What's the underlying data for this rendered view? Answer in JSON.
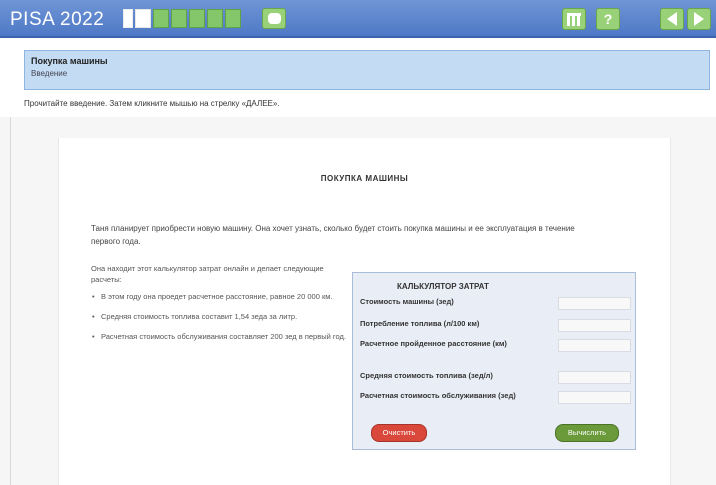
{
  "app": {
    "logo": "PISA 2022"
  },
  "progress": {
    "segments": 7,
    "completed": 1
  },
  "toolbar": {
    "calculator_icon": "calculator-icon",
    "help_label": "?",
    "back_icon": "arrow-left-icon",
    "next_icon": "arrow-right-icon"
  },
  "unit": {
    "title": "Покупка машины",
    "subtitle": "Введение"
  },
  "instruction": "Прочитайте введение. Затем кликните мышью на стрелку «ДАЛЕЕ».",
  "article": {
    "title": "ПОКУПКА МАШИНЫ",
    "intro": "Таня планирует приобрести новую машину. Она хочет узнать, сколько будет стоить покупка машины и ее эксплуатация в течение первого года.",
    "lead": "Она находит этот калькулятор затрат онлайн и делает следующие расчеты:",
    "bullets": [
      "В этом году она проедет расчетное расстояние, равное 20 000 км.",
      "Средняя стоимость топлива составит 1,54 зеда за литр.",
      "Расчетная стоимость обслуживания составляет 200 зед в первый год."
    ]
  },
  "calculator": {
    "title": "КАЛЬКУЛЯТОР ЗАТРАТ",
    "fields": [
      {
        "label": "Стоимость машины (зед)",
        "value": ""
      },
      {
        "label": "Потребление топлива (л/100 км)",
        "value": ""
      },
      {
        "label": "Расчетное пройденное расстояние (км)",
        "value": ""
      },
      {
        "label": "Средняя стоимость топлива (зед/л)",
        "value": ""
      },
      {
        "label": "Расчетная стоимость обслуживания (зед)",
        "value": ""
      }
    ],
    "clear_label": "Очистить",
    "calc_label": "Вычислить"
  }
}
